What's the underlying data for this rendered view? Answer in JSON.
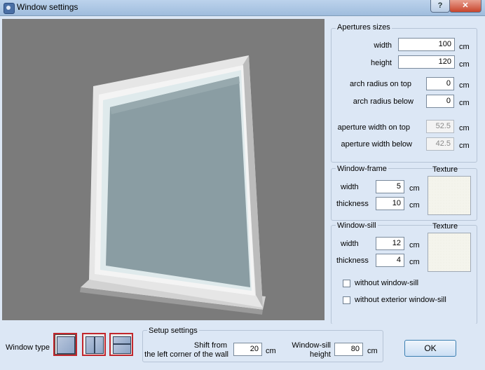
{
  "window": {
    "title": "Window settings",
    "help": "?",
    "close": "✕"
  },
  "apertures": {
    "legend": "Apertures sizes",
    "width_label": "width",
    "width_value": "100",
    "height_label": "height",
    "height_value": "120",
    "arch_top_label": "arch radius on top",
    "arch_top_value": "0",
    "arch_below_label": "arch radius below",
    "arch_below_value": "0",
    "ap_width_top_label": "aperture width on top",
    "ap_width_top_value": "52.5",
    "ap_width_below_label": "aperture width below",
    "ap_width_below_value": "42.5",
    "unit": "cm"
  },
  "frame": {
    "legend": "Window-frame",
    "texture_label": "Texture",
    "width_label": "width",
    "width_value": "5",
    "thickness_label": "thickness",
    "thickness_value": "10",
    "unit": "cm"
  },
  "sill": {
    "legend": "Window-sill",
    "texture_label": "Texture",
    "width_label": "width",
    "width_value": "12",
    "thickness_label": "thickness",
    "thickness_value": "4",
    "unit": "cm",
    "no_sill_label": "without window-sill",
    "no_ext_sill_label": "without exterior window-sill"
  },
  "bottom": {
    "window_type_label": "Window type",
    "setup_legend": "Setup settings",
    "shift_label_1": "Shift from",
    "shift_label_2": "the left corner of the wall",
    "shift_value": "20",
    "shift_unit": "cm",
    "sill_height_label_1": "Window-sill",
    "sill_height_label_2": "height",
    "sill_height_value": "80",
    "sill_height_unit": "cm",
    "ok": "OK"
  },
  "colors": {
    "accent": "#c2272d",
    "panel_bg": "#dce7f5",
    "viewport_bg": "#7b7b7b"
  }
}
